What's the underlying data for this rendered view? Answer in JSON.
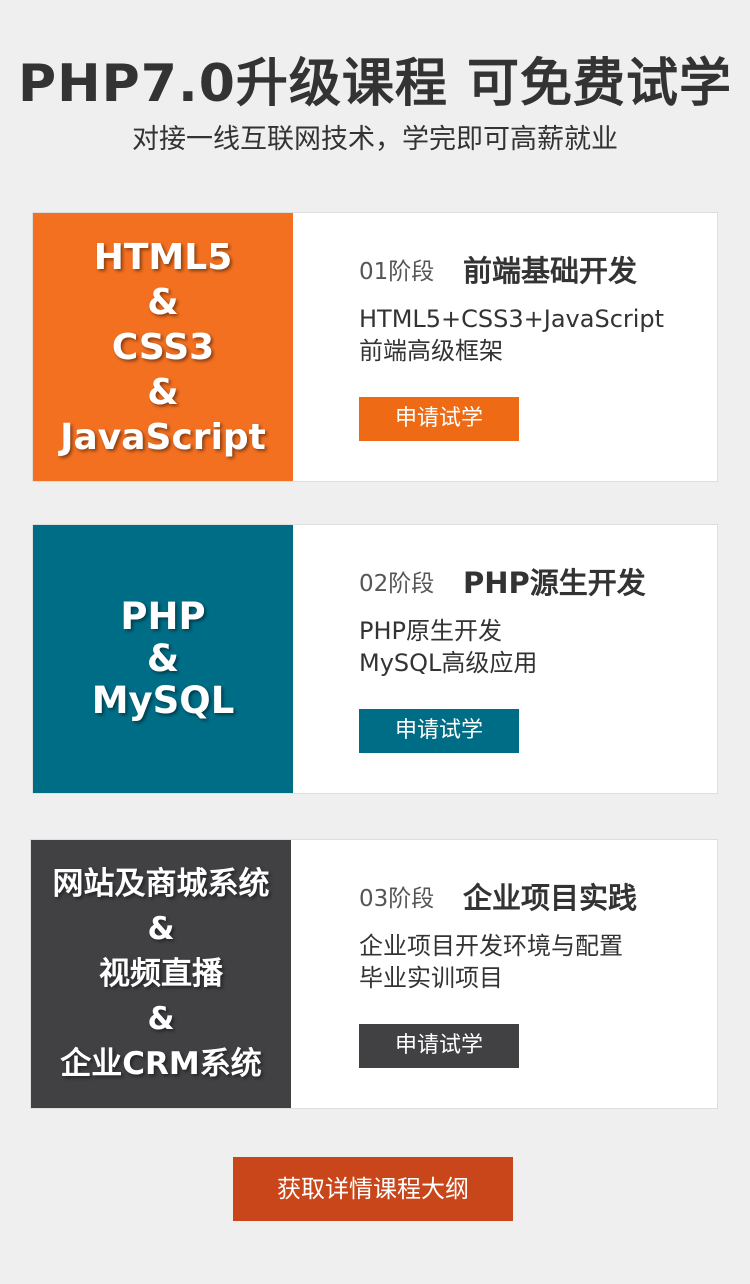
{
  "header": {
    "title": "PHP7.0升级课程 可免费试学",
    "subtitle": "对接一线互联网技术，学完即可高薪就业"
  },
  "colors": {
    "stage1": "#f37021",
    "stage1_button": "#ef6a14",
    "stage2": "#006d86",
    "stage3": "#414043",
    "outline_button": "#c9461a"
  },
  "stages": [
    {
      "panel_lines": [
        "HTML5",
        "&",
        "CSS3",
        "&",
        "JavaScript"
      ],
      "stage_label": "01阶段",
      "stage_title": "前端基础开发",
      "desc_lines": [
        "HTML5+CSS3+JavaScript",
        "前端高级框架"
      ],
      "button_label": "申请试学"
    },
    {
      "panel_lines": [
        "PHP",
        "&",
        "MySQL"
      ],
      "stage_label": "02阶段",
      "stage_title": "PHP源生开发",
      "desc_lines": [
        "PHP原生开发",
        "MySQL高级应用"
      ],
      "button_label": "申请试学"
    },
    {
      "panel_lines": [
        "网站及商城系统",
        "&",
        "视频直播",
        "&",
        "企业CRM系统"
      ],
      "stage_label": "03阶段",
      "stage_title": "企业项目实践",
      "desc_lines": [
        "企业项目开发环境与配置",
        "毕业实训项目"
      ],
      "button_label": "申请试学"
    }
  ],
  "outline_button_label": "获取详情课程大纲"
}
